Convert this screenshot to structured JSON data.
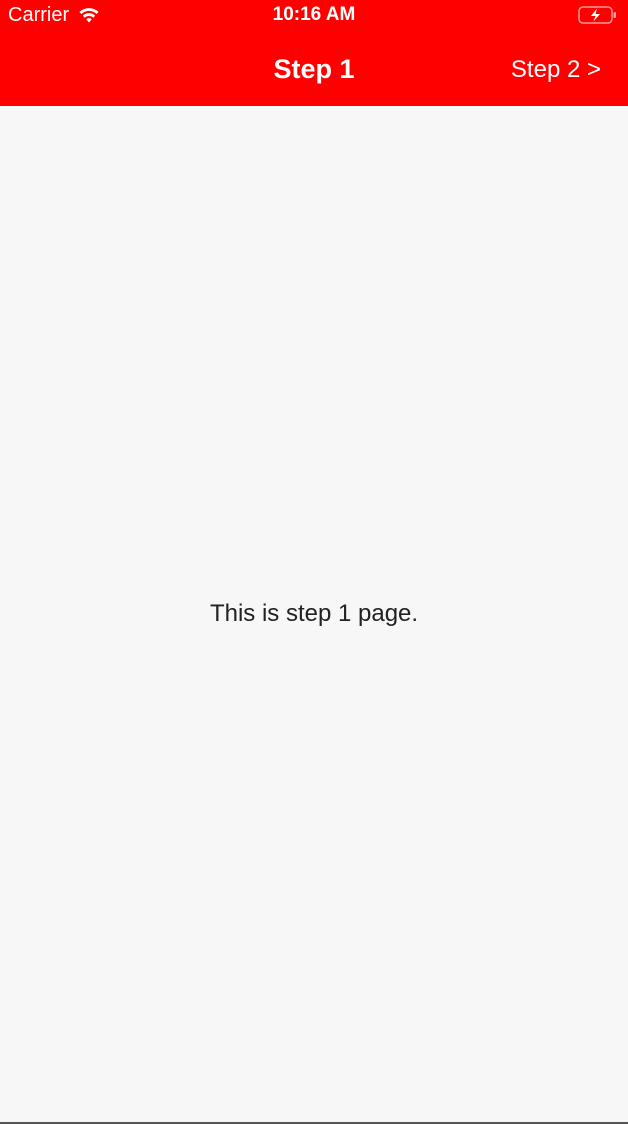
{
  "status_bar": {
    "carrier": "Carrier",
    "time": "10:16 AM",
    "wifi_icon": "wifi-icon",
    "battery_icon": "battery-charging-icon"
  },
  "nav_bar": {
    "title": "Step 1",
    "next_label": "Step 2 >"
  },
  "content": {
    "message": "This is step 1 page."
  },
  "colors": {
    "header_background": "#ff0000",
    "header_text": "#ffffff",
    "page_background": "#f7f7f7",
    "body_text": "#222222"
  }
}
